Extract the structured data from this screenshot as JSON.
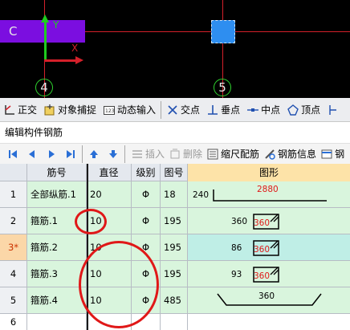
{
  "viewport": {
    "beam_label": "C",
    "axis_y_label": "Y",
    "axis_x_label": "X",
    "grid_axis_1": "4",
    "grid_axis_2": "5"
  },
  "snap_toolbar": {
    "ortho": "正交",
    "object_snap": "对象捕捉",
    "dynamic_input": "动态输入",
    "intersection": "交点",
    "perpendicular": "垂点",
    "midpoint": "中点",
    "vertex": "顶点"
  },
  "panel": {
    "title": "编辑构件钢筋"
  },
  "rebar_toolbar": {
    "insert": "插入",
    "delete": "删除",
    "scale_rebar": "缩尺配筋",
    "rebar_info": "钢筋信息",
    "truncated": "钢"
  },
  "table": {
    "headers": {
      "name": "筋号",
      "diameter": "直径(mm)",
      "grade": "级别",
      "figure_no": "图号",
      "shape": "图形"
    },
    "rows": [
      {
        "num": "1",
        "name": "全部纵筋.1",
        "diameter": "20",
        "grade": "Φ",
        "figure_no": "18",
        "shape_left": "240",
        "shape_top": "2880"
      },
      {
        "num": "2",
        "name": "箍筋.1",
        "diameter": "10",
        "grade": "Φ",
        "figure_no": "195",
        "shape_left": "360",
        "shape_inner": "360"
      },
      {
        "num": "3*",
        "name": "箍筋.2",
        "diameter": "10",
        "grade": "Φ",
        "figure_no": "195",
        "shape_left": "86",
        "shape_inner": "360"
      },
      {
        "num": "4",
        "name": "箍筋.3",
        "diameter": "10",
        "grade": "Φ",
        "figure_no": "195",
        "shape_left": "93",
        "shape_inner": "360"
      },
      {
        "num": "5",
        "name": "箍筋.4",
        "diameter": "10",
        "grade": "Φ",
        "figure_no": "485",
        "shape_mid": "360"
      },
      {
        "num": "6"
      }
    ]
  },
  "colors": {
    "viewport_bg": "#000000",
    "beam": "#7b0ee0",
    "column": "#2e8ef0",
    "grid_line": "#d4202a",
    "cell_green": "#d9f5dd",
    "shape_header": "#fde3a8",
    "annotation_red": "#e01818"
  }
}
